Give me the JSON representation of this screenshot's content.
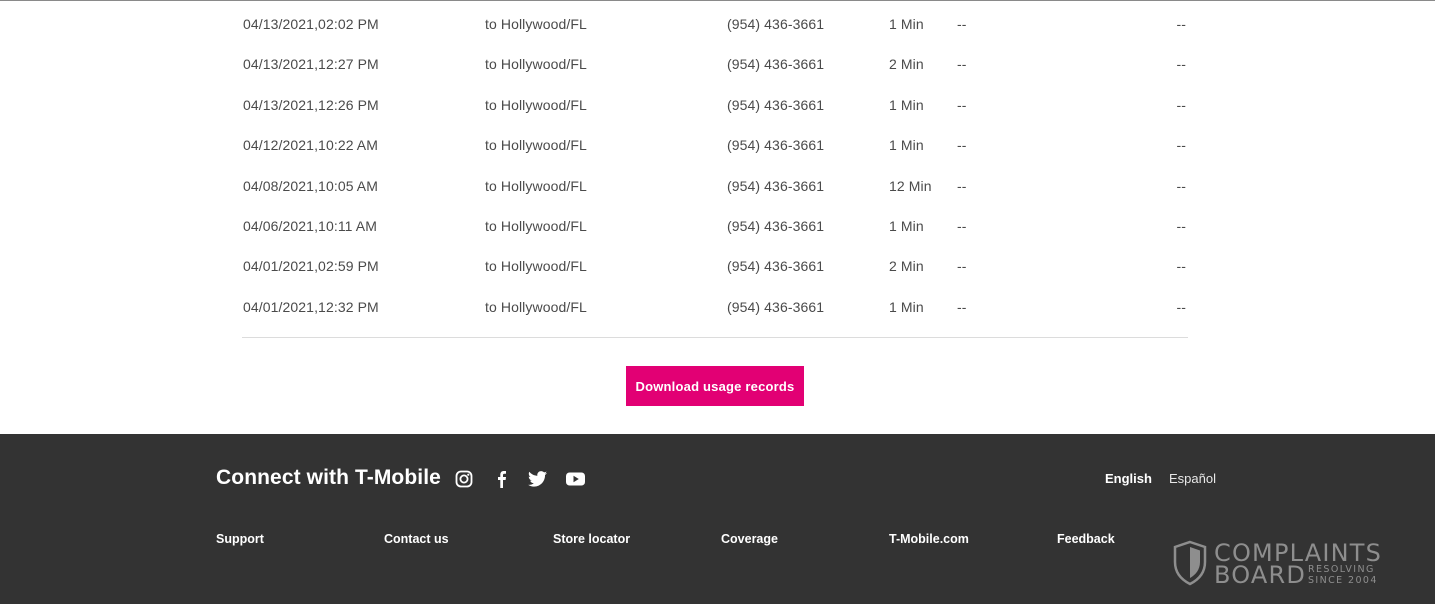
{
  "usage": {
    "rows": [
      {
        "date": "04/13/2021,02:02 PM",
        "destination": "to Hollywood/FL",
        "number": "(954) 436-3661",
        "minutes": "1 Min",
        "col5": "--",
        "col6": "--"
      },
      {
        "date": "04/13/2021,12:27 PM",
        "destination": "to Hollywood/FL",
        "number": "(954) 436-3661",
        "minutes": "2 Min",
        "col5": "--",
        "col6": "--"
      },
      {
        "date": "04/13/2021,12:26 PM",
        "destination": "to Hollywood/FL",
        "number": "(954) 436-3661",
        "minutes": "1 Min",
        "col5": "--",
        "col6": "--"
      },
      {
        "date": "04/12/2021,10:22 AM",
        "destination": "to Hollywood/FL",
        "number": "(954) 436-3661",
        "minutes": "1 Min",
        "col5": "--",
        "col6": "--"
      },
      {
        "date": "04/08/2021,10:05 AM",
        "destination": "to Hollywood/FL",
        "number": "(954) 436-3661",
        "minutes": "12 Min",
        "col5": "--",
        "col6": "--"
      },
      {
        "date": "04/06/2021,10:11 AM",
        "destination": "to Hollywood/FL",
        "number": "(954) 436-3661",
        "minutes": "1 Min",
        "col5": "--",
        "col6": "--"
      },
      {
        "date": "04/01/2021,02:59 PM",
        "destination": "to Hollywood/FL",
        "number": "(954) 436-3661",
        "minutes": "2 Min",
        "col5": "--",
        "col6": "--"
      },
      {
        "date": "04/01/2021,12:32 PM",
        "destination": "to Hollywood/FL",
        "number": "(954) 436-3661",
        "minutes": "1 Min",
        "col5": "--",
        "col6": "--"
      }
    ],
    "download_label": "Download usage records"
  },
  "footer": {
    "connect_title": "Connect with T-Mobile",
    "social_icons": [
      "instagram-icon",
      "facebook-icon",
      "twitter-icon",
      "youtube-icon"
    ],
    "languages": [
      "English",
      "Español"
    ],
    "links": [
      "Support",
      "Contact us",
      "Store locator",
      "Coverage",
      "T-Mobile.com",
      "Feedback"
    ]
  },
  "watermark": {
    "line1": "COMPLAINTS",
    "line2": "BOARD",
    "tag1": "RESOLVING",
    "tag2": "SINCE 2004"
  },
  "colors": {
    "brand_magenta": "#e20074",
    "footer_bg": "#333333",
    "text": "#4a4a4a"
  }
}
